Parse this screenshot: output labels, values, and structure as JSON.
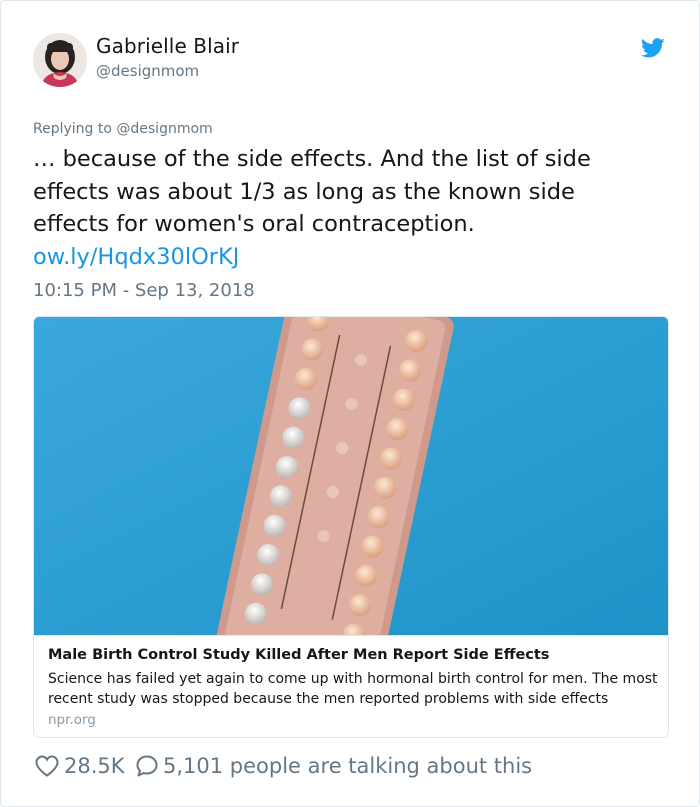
{
  "author": {
    "name": "Gabrielle Blair",
    "handle": "@designmom"
  },
  "reply_context": {
    "prefix": "Replying to",
    "handle": "@designmom"
  },
  "tweet": {
    "text": "… because of the side effects. And the list of side effects was about 1/3 as long as the known side effects for women's oral contraception.",
    "link": "ow.ly/Hqdx30lOrKJ",
    "timestamp": "10:15 PM - Sep 13, 2018"
  },
  "card": {
    "image_alt": "blister pack of birth control pills on blue background",
    "title": "Male Birth Control Study Killed After Men Report Side Effects",
    "description": "Science has failed yet again to come up with hormonal birth control for men. The most recent study was stopped because the men reported problems with side effects",
    "domain": "npr.org"
  },
  "actions": {
    "likes": "28.5K",
    "conversation": "5,101 people are talking about this"
  },
  "colors": {
    "link": "#1b95e0",
    "secondary": "#657786",
    "twitter_blue": "#1da1f2",
    "card_background": "#2ea0d6"
  },
  "icons": {
    "brand": "twitter-bird-icon",
    "like": "heart-icon",
    "reply": "speech-bubble-icon"
  }
}
